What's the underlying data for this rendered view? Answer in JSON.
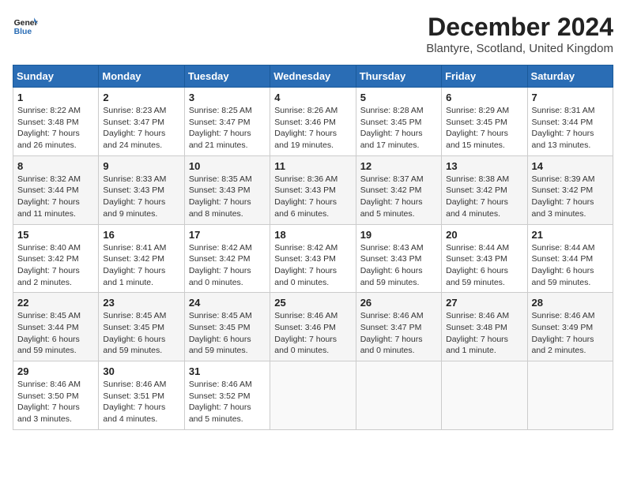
{
  "logo": {
    "line1": "General",
    "line2": "Blue"
  },
  "title": "December 2024",
  "subtitle": "Blantyre, Scotland, United Kingdom",
  "days_of_week": [
    "Sunday",
    "Monday",
    "Tuesday",
    "Wednesday",
    "Thursday",
    "Friday",
    "Saturday"
  ],
  "weeks": [
    [
      {
        "day": "1",
        "info": "Sunrise: 8:22 AM\nSunset: 3:48 PM\nDaylight: 7 hours\nand 26 minutes."
      },
      {
        "day": "2",
        "info": "Sunrise: 8:23 AM\nSunset: 3:47 PM\nDaylight: 7 hours\nand 24 minutes."
      },
      {
        "day": "3",
        "info": "Sunrise: 8:25 AM\nSunset: 3:47 PM\nDaylight: 7 hours\nand 21 minutes."
      },
      {
        "day": "4",
        "info": "Sunrise: 8:26 AM\nSunset: 3:46 PM\nDaylight: 7 hours\nand 19 minutes."
      },
      {
        "day": "5",
        "info": "Sunrise: 8:28 AM\nSunset: 3:45 PM\nDaylight: 7 hours\nand 17 minutes."
      },
      {
        "day": "6",
        "info": "Sunrise: 8:29 AM\nSunset: 3:45 PM\nDaylight: 7 hours\nand 15 minutes."
      },
      {
        "day": "7",
        "info": "Sunrise: 8:31 AM\nSunset: 3:44 PM\nDaylight: 7 hours\nand 13 minutes."
      }
    ],
    [
      {
        "day": "8",
        "info": "Sunrise: 8:32 AM\nSunset: 3:44 PM\nDaylight: 7 hours\nand 11 minutes."
      },
      {
        "day": "9",
        "info": "Sunrise: 8:33 AM\nSunset: 3:43 PM\nDaylight: 7 hours\nand 9 minutes."
      },
      {
        "day": "10",
        "info": "Sunrise: 8:35 AM\nSunset: 3:43 PM\nDaylight: 7 hours\nand 8 minutes."
      },
      {
        "day": "11",
        "info": "Sunrise: 8:36 AM\nSunset: 3:43 PM\nDaylight: 7 hours\nand 6 minutes."
      },
      {
        "day": "12",
        "info": "Sunrise: 8:37 AM\nSunset: 3:42 PM\nDaylight: 7 hours\nand 5 minutes."
      },
      {
        "day": "13",
        "info": "Sunrise: 8:38 AM\nSunset: 3:42 PM\nDaylight: 7 hours\nand 4 minutes."
      },
      {
        "day": "14",
        "info": "Sunrise: 8:39 AM\nSunset: 3:42 PM\nDaylight: 7 hours\nand 3 minutes."
      }
    ],
    [
      {
        "day": "15",
        "info": "Sunrise: 8:40 AM\nSunset: 3:42 PM\nDaylight: 7 hours\nand 2 minutes."
      },
      {
        "day": "16",
        "info": "Sunrise: 8:41 AM\nSunset: 3:42 PM\nDaylight: 7 hours\nand 1 minute."
      },
      {
        "day": "17",
        "info": "Sunrise: 8:42 AM\nSunset: 3:42 PM\nDaylight: 7 hours\nand 0 minutes."
      },
      {
        "day": "18",
        "info": "Sunrise: 8:42 AM\nSunset: 3:43 PM\nDaylight: 7 hours\nand 0 minutes."
      },
      {
        "day": "19",
        "info": "Sunrise: 8:43 AM\nSunset: 3:43 PM\nDaylight: 6 hours\nand 59 minutes."
      },
      {
        "day": "20",
        "info": "Sunrise: 8:44 AM\nSunset: 3:43 PM\nDaylight: 6 hours\nand 59 minutes."
      },
      {
        "day": "21",
        "info": "Sunrise: 8:44 AM\nSunset: 3:44 PM\nDaylight: 6 hours\nand 59 minutes."
      }
    ],
    [
      {
        "day": "22",
        "info": "Sunrise: 8:45 AM\nSunset: 3:44 PM\nDaylight: 6 hours\nand 59 minutes."
      },
      {
        "day": "23",
        "info": "Sunrise: 8:45 AM\nSunset: 3:45 PM\nDaylight: 6 hours\nand 59 minutes."
      },
      {
        "day": "24",
        "info": "Sunrise: 8:45 AM\nSunset: 3:45 PM\nDaylight: 6 hours\nand 59 minutes."
      },
      {
        "day": "25",
        "info": "Sunrise: 8:46 AM\nSunset: 3:46 PM\nDaylight: 7 hours\nand 0 minutes."
      },
      {
        "day": "26",
        "info": "Sunrise: 8:46 AM\nSunset: 3:47 PM\nDaylight: 7 hours\nand 0 minutes."
      },
      {
        "day": "27",
        "info": "Sunrise: 8:46 AM\nSunset: 3:48 PM\nDaylight: 7 hours\nand 1 minute."
      },
      {
        "day": "28",
        "info": "Sunrise: 8:46 AM\nSunset: 3:49 PM\nDaylight: 7 hours\nand 2 minutes."
      }
    ],
    [
      {
        "day": "29",
        "info": "Sunrise: 8:46 AM\nSunset: 3:50 PM\nDaylight: 7 hours\nand 3 minutes."
      },
      {
        "day": "30",
        "info": "Sunrise: 8:46 AM\nSunset: 3:51 PM\nDaylight: 7 hours\nand 4 minutes."
      },
      {
        "day": "31",
        "info": "Sunrise: 8:46 AM\nSunset: 3:52 PM\nDaylight: 7 hours\nand 5 minutes."
      },
      {
        "day": "",
        "info": ""
      },
      {
        "day": "",
        "info": ""
      },
      {
        "day": "",
        "info": ""
      },
      {
        "day": "",
        "info": ""
      }
    ]
  ]
}
